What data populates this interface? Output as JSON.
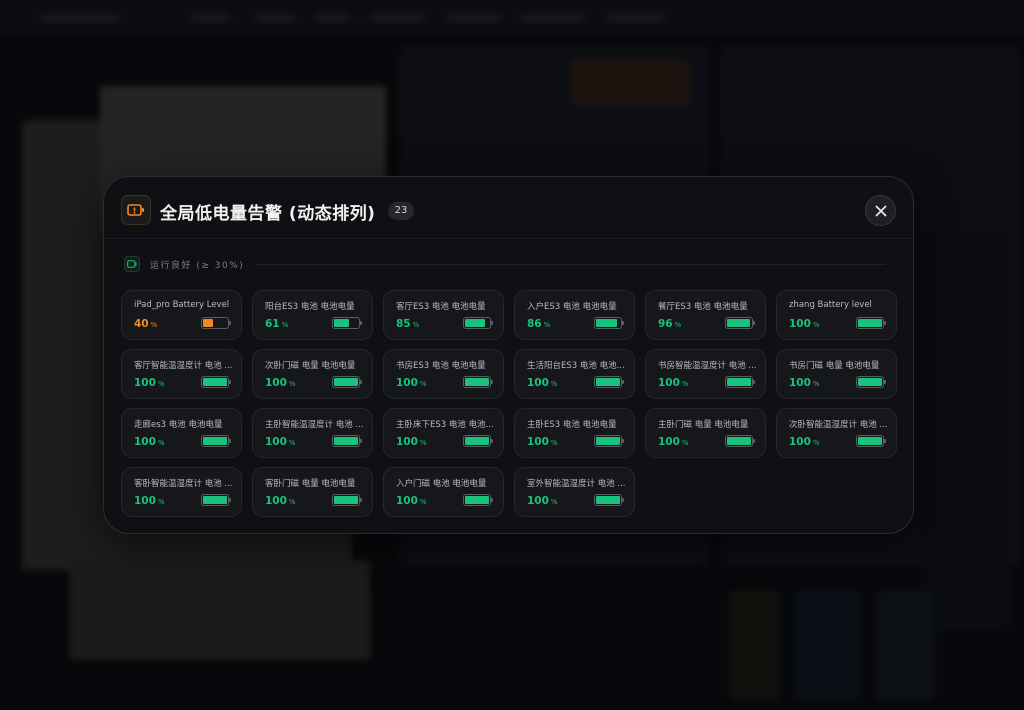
{
  "modal": {
    "title": "全局低电量告警 (动态排列)",
    "count": "23",
    "warn_icon": "battery-alert-icon",
    "close_icon": "close-icon"
  },
  "section": {
    "label": "运行良好 (≥ 30%)",
    "icon": "battery-ok-icon"
  },
  "colors": {
    "ok": "#19c37d",
    "low": "#f08a24"
  },
  "devices": [
    {
      "name": "iPad_pro Battery Level",
      "percent": 40,
      "unit": "%",
      "status": "low"
    },
    {
      "name": "阳台ES3 电池 电池电量",
      "percent": 61,
      "unit": "%",
      "status": "ok"
    },
    {
      "name": "客厅ES3 电池 电池电量",
      "percent": 85,
      "unit": "%",
      "status": "ok"
    },
    {
      "name": "入户ES3 电池 电池电量",
      "percent": 86,
      "unit": "%",
      "status": "ok"
    },
    {
      "name": "餐厅ES3 电池 电池电量",
      "percent": 96,
      "unit": "%",
      "status": "ok"
    },
    {
      "name": "zhang Battery level",
      "percent": 100,
      "unit": "%",
      "status": "ok"
    },
    {
      "name": "客厅智能温湿度计 电池 ...",
      "percent": 100,
      "unit": "%",
      "status": "ok"
    },
    {
      "name": "次卧门磁 电量 电池电量",
      "percent": 100,
      "unit": "%",
      "status": "ok"
    },
    {
      "name": "书房ES3 电池 电池电量",
      "percent": 100,
      "unit": "%",
      "status": "ok"
    },
    {
      "name": "生活阳台ES3 电池 电池...",
      "percent": 100,
      "unit": "%",
      "status": "ok"
    },
    {
      "name": "书房智能温湿度计 电池 ...",
      "percent": 100,
      "unit": "%",
      "status": "ok"
    },
    {
      "name": "书房门磁 电量 电池电量",
      "percent": 100,
      "unit": "%",
      "status": "ok"
    },
    {
      "name": "走廊es3 电池 电池电量",
      "percent": 100,
      "unit": "%",
      "status": "ok"
    },
    {
      "name": "主卧智能温湿度计 电池 ...",
      "percent": 100,
      "unit": "%",
      "status": "ok"
    },
    {
      "name": "主卧床下ES3 电池 电池...",
      "percent": 100,
      "unit": "%",
      "status": "ok"
    },
    {
      "name": "主卧ES3 电池 电池电量",
      "percent": 100,
      "unit": "%",
      "status": "ok"
    },
    {
      "name": "主卧门磁 电量 电池电量",
      "percent": 100,
      "unit": "%",
      "status": "ok"
    },
    {
      "name": "次卧智能温湿度计 电池 ...",
      "percent": 100,
      "unit": "%",
      "status": "ok"
    },
    {
      "name": "客卧智能温湿度计 电池 ...",
      "percent": 100,
      "unit": "%",
      "status": "ok"
    },
    {
      "name": "客卧门磁 电量 电池电量",
      "percent": 100,
      "unit": "%",
      "status": "ok"
    },
    {
      "name": "入户门磁 电池 电池电量",
      "percent": 100,
      "unit": "%",
      "status": "ok"
    },
    {
      "name": "室外智能温湿度计 电池 ...",
      "percent": 100,
      "unit": "%",
      "status": "ok"
    }
  ]
}
